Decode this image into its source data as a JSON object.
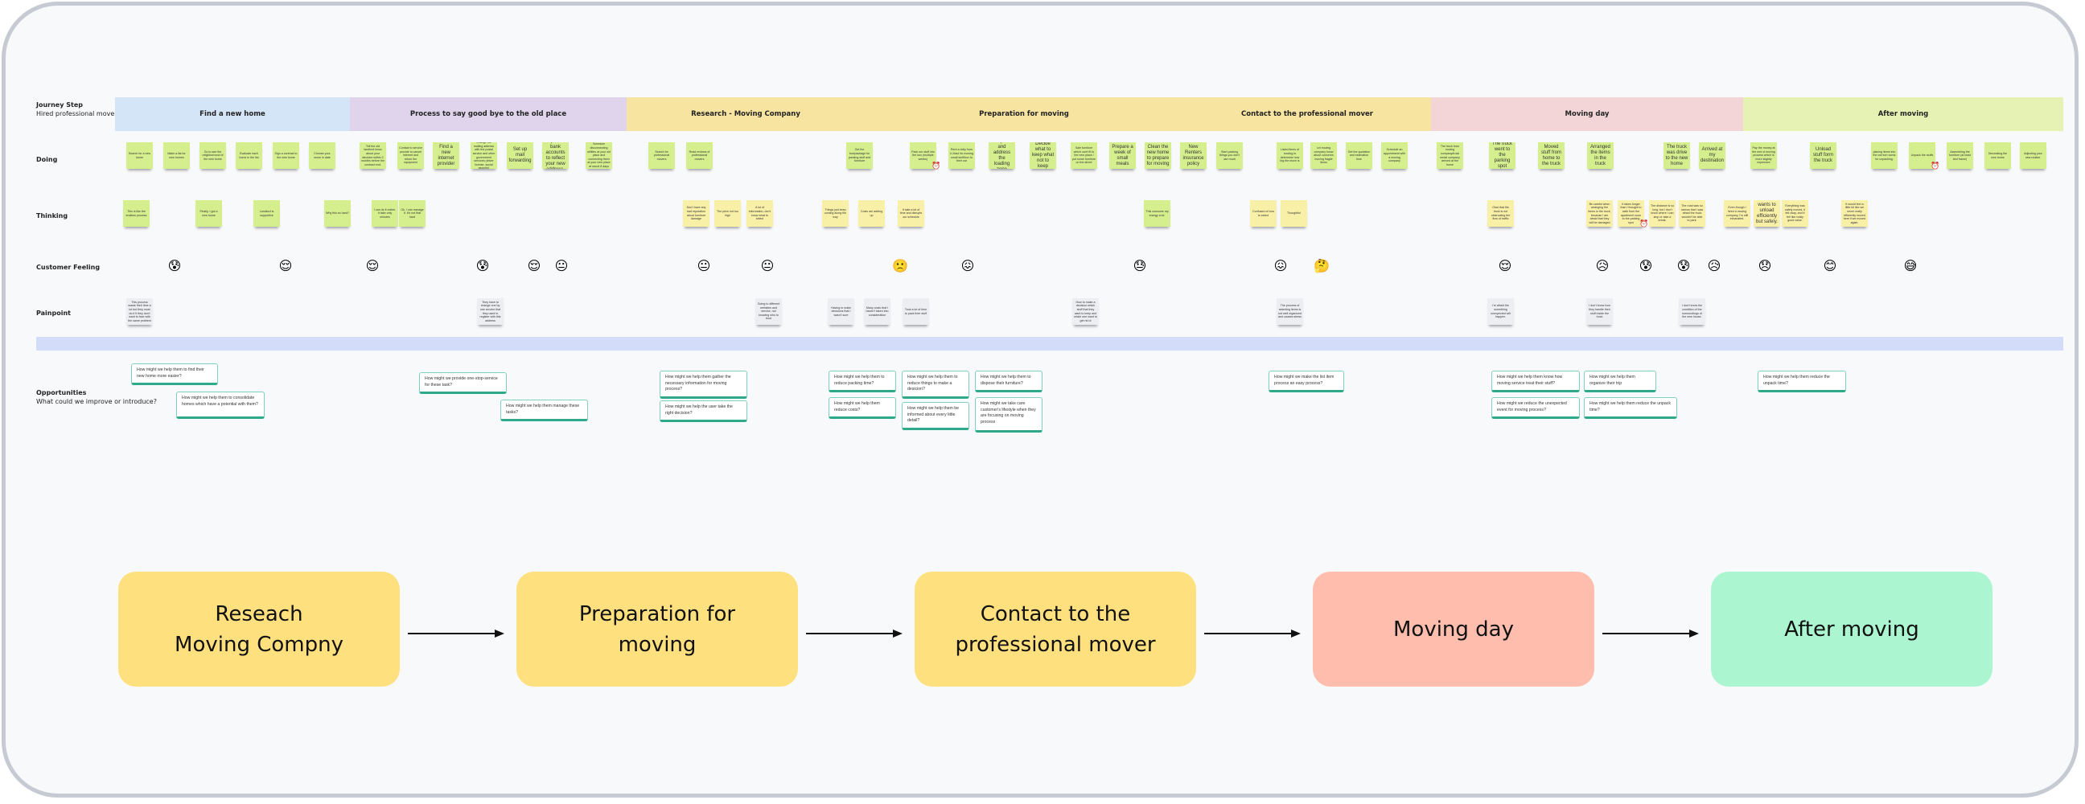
{
  "row_labels": {
    "journey_step": "Journey Step",
    "journey_step_sub": "Hired professional movers",
    "doing": "Doing",
    "thinking": "Thinking",
    "customer_feeling": "Customer Feeling",
    "painpoint": "Painpoint",
    "opportunities": "Opportunities",
    "opportunities_sub": "What could we improve or introduce?"
  },
  "stages": [
    {
      "label": "Find a new home",
      "color": "#d4e5f7"
    },
    {
      "label": "Process to say good bye to the old place",
      "color": "#dfd4ec"
    },
    {
      "label": "Research - Moving Company",
      "color": "#f6e4a0"
    },
    {
      "label": "Preparation for moving",
      "color": "#f6e4a0"
    },
    {
      "label": "Contact to the professional mover",
      "color": "#f6e4a0"
    },
    {
      "label": "Moving day",
      "color": "#f3d5d8"
    },
    {
      "label": "After moving",
      "color": "#e6f2b3"
    }
  ],
  "doing": [
    {
      "text": "Search for a new home"
    },
    {
      "text": "Make a list for new homes"
    },
    {
      "text": "Go to see the neighborhood of the new home"
    },
    {
      "text": "Evaluate each home in the list"
    },
    {
      "text": "Sign a contract to the new home"
    },
    {
      "text": "Choose your move in date"
    },
    {
      "text": "Tell the old landlord know about your decision within 2 months before the contract end."
    },
    {
      "text": "Contact to service provide to cancel internet and return the equipment"
    },
    {
      "text": "Find a new internet provider",
      "big": true
    },
    {
      "text": "Change the mailing address with the postal service and other government services (driver license, social security)"
    },
    {
      "text": "Set up mail forwarding",
      "big": true
    },
    {
      "text": "Update bank accounts to reflect your new address.",
      "big": true
    },
    {
      "text": "Schedule disconnecting utilities at your old place and connecting them at your new place at round 8 days"
    },
    {
      "text": "Search for professional movers"
    },
    {
      "text": "Read reviews of professional movers"
    },
    {
      "text": "Get the box/package for packing stuff and furniture"
    },
    {
      "text": "Pack our stuff into the box (multiple weeks)",
      "alarm": true
    },
    {
      "text": "Rent a dolly from U-Haul for moving small stuff/box to their car"
    },
    {
      "text": "Prepare and address the loading zone",
      "big": true
    },
    {
      "text": "Decide what to keep what not to keep",
      "big": true
    },
    {
      "text": "Sale furniture which can't fit to the new place / put some furniture on the street"
    },
    {
      "text": "Prepare a week of small meals",
      "big": true
    },
    {
      "text": "Clean the new home to prepare for moving",
      "big": true
    },
    {
      "text": "New Renters insurance policy",
      "big": true
    },
    {
      "text": "Start packing things you don't use much"
    },
    {
      "text": "Listed items of moving to determine how big the move is"
    },
    {
      "text": "Let moving company know about concerns moving fragile items"
    },
    {
      "text": "Get the quotation and estimation time"
    },
    {
      "text": "Schedule an appointment with a moving company"
    },
    {
      "text": "The truck from moving company/truck rental company arrived at the home"
    },
    {
      "text": "The truck went to the parking spot",
      "big": true
    },
    {
      "text": "Moved stuff from home to the truck",
      "big": true
    },
    {
      "text": "Arranged the items in the truck",
      "big": true
    },
    {
      "text": "The truck was drive to the new home",
      "big": true
    },
    {
      "text": "Arrived at my destination",
      "big": true
    },
    {
      "text": "Pay the money at the end of moving process which is more slightly expensive"
    },
    {
      "text": "Unload stuff form the truck",
      "big": true
    },
    {
      "text": "placing items into the correct rooms for unpacking."
    },
    {
      "text": "Unpack the stuffs",
      "alarm": true
    },
    {
      "text": "Assembling the furniture (at least bed frame)"
    },
    {
      "text": "Decorating the new home"
    },
    {
      "text": "Adjusting your new routine."
    }
  ],
  "thinking": [
    {
      "text": "This is like the endless process",
      "color": "green"
    },
    {
      "text": "Finally, I got a new home",
      "color": "green"
    },
    {
      "text": "Landlord is supportive",
      "color": "green"
    },
    {
      "text": "Why this so hard?",
      "color": "green"
    },
    {
      "text": "I can do it online. It take only minutes",
      "color": "green"
    },
    {
      "text": "Ok, I can manage it. It's not that hard",
      "color": "green"
    },
    {
      "text": "Don't have any bad reputation about furniture damage",
      "color": "yellow"
    },
    {
      "text": "The price not too high",
      "color": "yellow"
    },
    {
      "text": "A lot of information, don't know what to select",
      "color": "yellow"
    },
    {
      "text": "Things just keep coming along the way",
      "color": "yellow"
    },
    {
      "text": "Costs are adding up",
      "color": "yellow"
    },
    {
      "text": "It take a lot of time and disrupts our schedule",
      "color": "yellow"
    },
    {
      "text": "This consume my energy a lot.",
      "color": "green"
    },
    {
      "text": "Confused of how to select",
      "color": "yellow"
    },
    {
      "text": "Thoughtful",
      "color": "yellow"
    },
    {
      "text": "Glad that the truck is not obstructing the flow of traffic",
      "color": "yellow"
    },
    {
      "text": "Be careful when arranging the items in the truck, because I am afraid that they will be damaged",
      "color": "yellow"
    },
    {
      "text": "It takes longer than I thought to walk from the apartment room to the parking spot",
      "color": "yellow",
      "alarm": true
    },
    {
      "text": "The distance is so long, but I don't know where I can stop or take a break.",
      "color": "yellow"
    },
    {
      "text": "The road was so narrow that I was afraid the truck wouldn't be able to park.",
      "color": "yellow"
    },
    {
      "text": "Even though I hired a moving company, I'm still exhausted.",
      "color": "yellow"
    },
    {
      "text": "wants to unload efficiently but safely.",
      "color": "yellow",
      "big": true
    },
    {
      "text": "Everything was safely moved, it felt okay, and it felt like really good value.",
      "color": "yellow"
    },
    {
      "text": "It would feel a little bit like we never really efficiently moved here if we moved again.",
      "color": "yellow"
    }
  ],
  "feelings": [
    {
      "emoji": "😰",
      "name": "anxious-face-icon"
    },
    {
      "emoji": "😌",
      "name": "relieved-face-icon"
    },
    {
      "emoji": "😌",
      "name": "relieved-face-icon"
    },
    {
      "emoji": "😰",
      "name": "anxious-face-icon"
    },
    {
      "emoji": "😌",
      "name": "relieved-face-icon"
    },
    {
      "emoji": "😐",
      "name": "neutral-face-icon"
    },
    {
      "emoji": "😐",
      "name": "neutral-face-icon"
    },
    {
      "emoji": "😐",
      "name": "neutral-face-icon"
    },
    {
      "emoji": "🙁",
      "name": "frowning-face-icon"
    },
    {
      "emoji": "😖",
      "name": "confounded-face-icon"
    },
    {
      "emoji": "😓",
      "name": "downcast-sweat-face-icon"
    },
    {
      "emoji": "😖",
      "name": "confounded-face-icon"
    },
    {
      "emoji": "🤔",
      "name": "thinking-face-icon"
    },
    {
      "emoji": "😌",
      "name": "relieved-face-icon"
    },
    {
      "emoji": "😥",
      "name": "sad-relieved-face-icon"
    },
    {
      "emoji": "😰",
      "name": "anxious-face-icon"
    },
    {
      "emoji": "😰",
      "name": "anxious-face-icon"
    },
    {
      "emoji": "😥",
      "name": "sad-relieved-face-icon"
    },
    {
      "emoji": "😞",
      "name": "disappointed-face-icon"
    },
    {
      "emoji": "😊",
      "name": "smiling-face-icon"
    },
    {
      "emoji": "😅",
      "name": "grinning-sweat-face-icon"
    }
  ],
  "painpoints": [
    {
      "text": "This process waste their time a lot but they must do it if they don't want to face with the same problem"
    },
    {
      "text": "They have to change one by one service that they used to register with this address"
    },
    {
      "text": "Going to different websites and service, not knowing who to trust"
    },
    {
      "text": "Having to make decisions that I wasn't sure"
    },
    {
      "text": "Many costs that I haven't taken into consideration"
    },
    {
      "text": "Took a lot of time to pack their stuff"
    },
    {
      "text": "How to make a decision which stuff that they want to keep and which one want to get rid of"
    },
    {
      "text": "The process of selecting items is not well organized and causes stress"
    },
    {
      "text": "I'm afraid the something unexpected will happen."
    },
    {
      "text": "I don't know how they handle their stuff inside the truck"
    },
    {
      "text": "I don't know the condition of the surroundings of the new house."
    }
  ],
  "opportunities": [
    {
      "text": "How might we help them to find their new home more easier?"
    },
    {
      "text": "How might we help them to consolidate homes which have a potential with them?"
    },
    {
      "text": "How might we provide one-stop-service for these task?"
    },
    {
      "text": "How might we help them manage these tasks?"
    },
    {
      "text": "How might we help them gather the necessary information for moving process?"
    },
    {
      "text": "How might we help the user take the right decision?"
    },
    {
      "text": "How might we help them to reduce packing time?"
    },
    {
      "text": "How might we help them reduce costs?"
    },
    {
      "text": "How might we help them to reduce things to make a desicion?"
    },
    {
      "text": "How might we help them be informed about every little detail?"
    },
    {
      "text": "How might we help them to dispose their furniture?"
    },
    {
      "text": "How might we take care customer's lifestyle when they are focusing on moving process"
    },
    {
      "text": "How might we make the list item process an easy process?"
    },
    {
      "text": "How might we help them know how moving service treat their stuff?"
    },
    {
      "text": "How might we reduce the unexpected event for moving process?"
    },
    {
      "text": "How might we help them organize their trip"
    },
    {
      "text": "How might we help them reduce the unpack time?"
    },
    {
      "text": "How might we help them reduce the unpack time?"
    }
  ],
  "flow": [
    {
      "label": "Reseach\nMoving Compny",
      "color": "#ffe07f"
    },
    {
      "label": "Preparation for\nmoving",
      "color": "#ffe07f"
    },
    {
      "label": "Contact to the\nprofessional mover",
      "color": "#ffe07f"
    },
    {
      "label": "Moving day",
      "color": "#ffbdad"
    },
    {
      "label": "After moving",
      "color": "#abf5d1"
    }
  ]
}
